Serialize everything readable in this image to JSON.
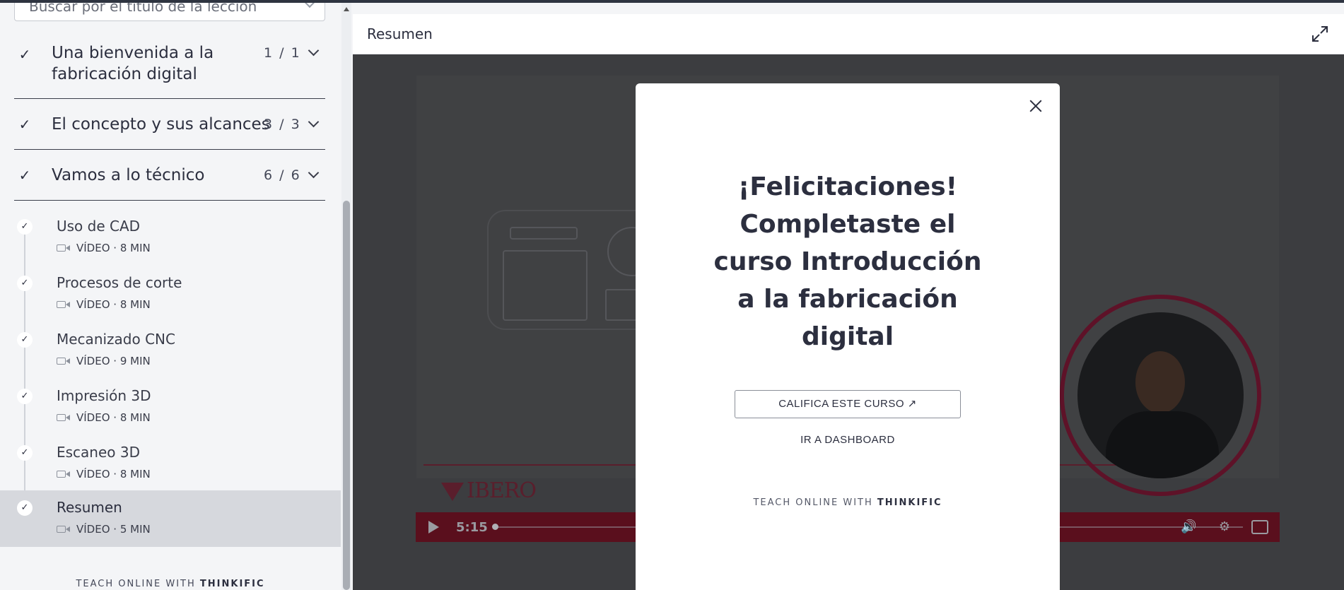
{
  "sidebar": {
    "search_placeholder": "Buscar por el título de la lección",
    "chapters": [
      {
        "title_line1": "Una bienvenida a la",
        "title_line2": "fabricación digital",
        "count": "1 / 1"
      },
      {
        "title_line1": "El concepto y sus alcances",
        "count": "3 / 3"
      },
      {
        "title_line1": "Vamos a lo técnico",
        "count": "6 / 6"
      }
    ],
    "lessons": [
      {
        "title": "Uso de CAD",
        "meta": "VÍDEO · 8 MIN"
      },
      {
        "title": "Procesos de corte",
        "meta": "VÍDEO · 8 MIN"
      },
      {
        "title": "Mecanizado CNC",
        "meta": "VÍDEO · 9 MIN"
      },
      {
        "title": "Impresión 3D",
        "meta": "VÍDEO · 8 MIN"
      },
      {
        "title": "Escaneo 3D",
        "meta": "VÍDEO · 8 MIN"
      },
      {
        "title": "Resumen",
        "meta": "VÍDEO · 5 MIN"
      }
    ],
    "footer_prefix": "TEACH ONLINE WITH",
    "footer_brand": "THINKIFIC"
  },
  "main": {
    "title": "Resumen"
  },
  "video": {
    "time": "5:15",
    "logo_text": "IBERO"
  },
  "modal": {
    "heading_lines": [
      "¡Felicitaciones!",
      "Completaste el",
      "curso Introducción",
      "a la fabricación",
      "digital"
    ],
    "rate_button": "CALIFICA ESTE CURSO  ↗",
    "dashboard_link": "IR A DASHBOARD",
    "footer_prefix": "TEACH ONLINE WITH",
    "footer_brand": "THINKIFIC"
  },
  "colors": {
    "brand_red": "#8b1a2e",
    "text_dark": "#2c2f3f",
    "active_lesson_bg": "#d6d8dd"
  }
}
